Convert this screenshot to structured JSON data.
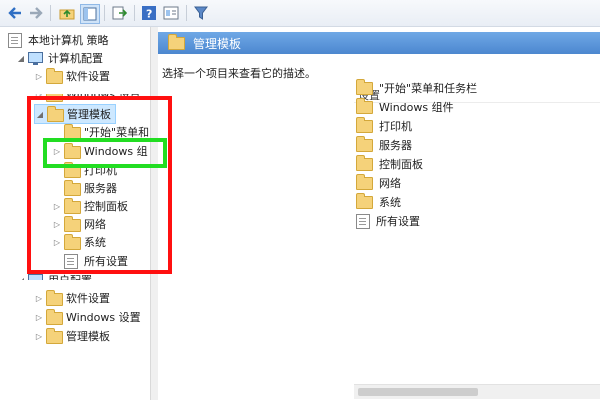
{
  "tree": {
    "root": "本地计算机 策略",
    "computer_config": "计算机配置",
    "software_settings": "软件设置",
    "windows_settings_partial": "Windows 设置",
    "admin_templates": "管理模板",
    "start_menu_partial": "\"开始\"菜单和",
    "windows_components_partial": "Windows 组",
    "printers": "打印机",
    "servers": "服务器",
    "control_panel": "控制面板",
    "network": "网络",
    "system": "系统",
    "all_settings": "所有设置",
    "user_config_partial": "用户配置",
    "user_software_settings": "软件设置",
    "user_windows_settings": "Windows 设置",
    "user_admin_templates": "管理模板"
  },
  "right": {
    "header_title": "管理模板",
    "description": "选择一个项目来查看它的描述。",
    "column_header": "设置",
    "items": [
      {
        "label": "\"开始\"菜单和任务栏",
        "icon": "folder-icon"
      },
      {
        "label": "Windows 组件",
        "icon": "folder-icon"
      },
      {
        "label": "打印机",
        "icon": "folder-icon"
      },
      {
        "label": "服务器",
        "icon": "folder-icon"
      },
      {
        "label": "控制面板",
        "icon": "folder-icon"
      },
      {
        "label": "网络",
        "icon": "folder-icon"
      },
      {
        "label": "系统",
        "icon": "folder-icon"
      },
      {
        "label": "所有设置",
        "icon": "policy-icon"
      }
    ]
  },
  "colors": {
    "highlight_red": "#ff1010",
    "highlight_green": "#22dd22",
    "header_blue": "#4c87cf"
  }
}
